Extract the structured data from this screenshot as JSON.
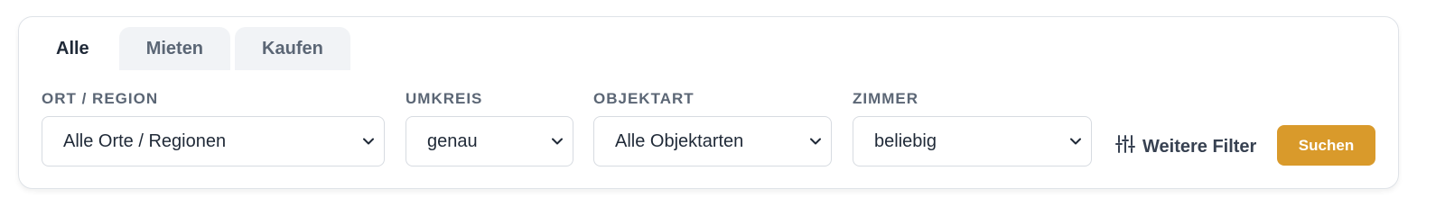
{
  "tabs": [
    {
      "label": "Alle",
      "active": true
    },
    {
      "label": "Mieten",
      "active": false
    },
    {
      "label": "Kaufen",
      "active": false
    }
  ],
  "fields": {
    "region": {
      "label": "ORT / REGION",
      "value": "Alle Orte / Regionen"
    },
    "radius": {
      "label": "UMKREIS",
      "value": "genau"
    },
    "type": {
      "label": "OBJEKTART",
      "value": "Alle Objektarten"
    },
    "rooms": {
      "label": "ZIMMER",
      "value": "beliebig"
    }
  },
  "more_filter": {
    "label": "Weitere Filter",
    "icon": "sliders-icon"
  },
  "search": {
    "label": "Suchen"
  },
  "colors": {
    "accent": "#d99a2b",
    "tab_inactive_bg": "#f1f3f6",
    "label": "#5b6675"
  }
}
